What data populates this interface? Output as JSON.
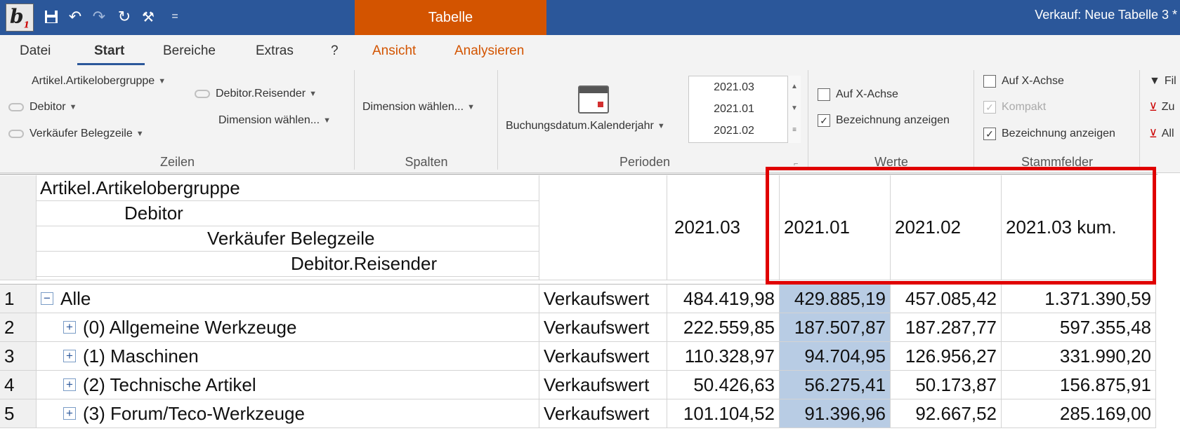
{
  "titlebar": {
    "contextual_tab": "Tabelle",
    "window_title": "Verkauf: Neue Tabelle 3 *",
    "logo_text": "b",
    "logo_sub": "1",
    "qa_more": "="
  },
  "tabs": [
    "Datei",
    "Start",
    "Bereiche",
    "Extras",
    "?",
    "Ansicht",
    "Analysieren"
  ],
  "ribbon": {
    "zeilen": {
      "items": [
        "Artikel.Artikelobergruppe",
        "Debitor",
        "Verkäufer Belegzeile",
        "Debitor.Reisender",
        "Dimension wählen..."
      ],
      "label": "Zeilen"
    },
    "spalten": {
      "item": "Dimension wählen...",
      "label": "Spalten"
    },
    "perioden": {
      "dimension": "Buchungsdatum.Kalenderjahr",
      "list": [
        "2021.03",
        "2021.01",
        "2021.02"
      ],
      "label": "Perioden"
    },
    "werte": {
      "options": [
        {
          "label": "Auf X-Achse",
          "checked": false
        },
        {
          "label": "Bezeichnung anzeigen",
          "checked": true
        }
      ],
      "label": "Werte"
    },
    "stammfelder": {
      "options": [
        {
          "label": "Auf X-Achse",
          "checked": false,
          "disabled": false
        },
        {
          "label": "Kompakt",
          "checked": true,
          "disabled": true
        },
        {
          "label": "Bezeichnung anzeigen",
          "checked": true,
          "disabled": false
        }
      ],
      "label": "Stammfelder"
    },
    "filter": {
      "items": [
        "Fil",
        "Zu",
        "All"
      ]
    }
  },
  "table": {
    "row_dimensions": [
      "Artikel.Artikelobergruppe",
      "Debitor",
      "Verkäufer Belegzeile",
      "Debitor.Reisender"
    ],
    "columns": [
      "2021.03",
      "2021.01",
      "2021.02",
      "2021.03 kum."
    ],
    "rows": [
      {
        "num": "1",
        "label": "Alle",
        "measure": "Verkaufswert",
        "values": [
          "484.419,98",
          "429.885,19",
          "457.085,42",
          "1.371.390,59"
        ]
      },
      {
        "num": "2",
        "label": "(0) Allgemeine Werkzeuge",
        "measure": "Verkaufswert",
        "values": [
          "222.559,85",
          "187.507,87",
          "187.287,77",
          "597.355,48"
        ]
      },
      {
        "num": "3",
        "label": "(1) Maschinen",
        "measure": "Verkaufswert",
        "values": [
          "110.328,97",
          "94.704,95",
          "126.956,27",
          "331.990,20"
        ]
      },
      {
        "num": "4",
        "label": "(2) Technische Artikel",
        "measure": "Verkaufswert",
        "values": [
          "50.426,63",
          "56.275,41",
          "50.173,87",
          "156.875,91"
        ]
      },
      {
        "num": "5",
        "label": "(3) Forum/Teco-Werkzeuge",
        "measure": "Verkaufswert",
        "values": [
          "101.104,52",
          "91.396,96",
          "92.667,52",
          "285.169,00"
        ]
      }
    ]
  },
  "colors": {
    "title_blue": "#2b579a",
    "context_orange": "#d35400",
    "highlight": "#b8cce4",
    "annotation_red": "#e00000"
  }
}
